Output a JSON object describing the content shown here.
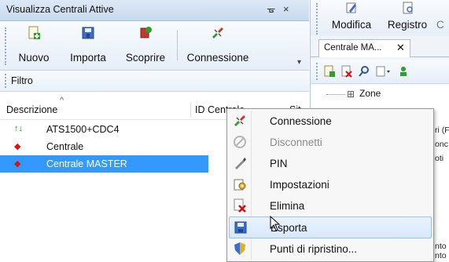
{
  "left_panel": {
    "title": "Visualizza Centrali Attive",
    "pin_glyph": "ᚗ",
    "close_glyph": "×",
    "toolbar": {
      "nuovo": "Nuovo",
      "importa": "Importa",
      "scoprire": "Scoprire",
      "connessione": "Connessione",
      "overflow_glyph": "▾"
    },
    "filter_label": "Filtro",
    "columns": {
      "descrizione": "Descrizione",
      "id_centrale": "ID Centrale",
      "site": "Sit"
    },
    "rows": [
      {
        "icon": "↑↓",
        "icon_name": "updown-arrows-icon",
        "icon_color": "#1a9e1a",
        "label": "ATS1500+CDC4"
      },
      {
        "icon": "◆",
        "icon_name": "red-diamond-icon",
        "icon_color": "#e01010",
        "label": "Centrale"
      },
      {
        "icon": "◆",
        "icon_name": "red-diamond-icon",
        "icon_color": "#e01010",
        "label": "Centrale MASTER"
      }
    ],
    "selected_row_color": "#3399ff"
  },
  "right_panel": {
    "toolbar": {
      "modifica": "Modifica",
      "registro": "Registro",
      "truncated": "C"
    },
    "tab": {
      "label": "Centrale MA...",
      "close_glyph": "✕"
    },
    "tree": {
      "zone": "Zone"
    },
    "peek_texts": [
      "ri (F",
      "onc",
      "oti",
      "nto",
      "nto"
    ]
  },
  "context_menu": {
    "items": [
      {
        "label": "Connessione",
        "icon_name": "connection-icon",
        "disabled": false,
        "highlighted": false
      },
      {
        "label": "Disconnetti",
        "icon_name": "disconnect-icon",
        "disabled": true,
        "highlighted": false
      },
      {
        "label": "PIN",
        "icon_name": "pin-pen-icon",
        "disabled": false,
        "highlighted": false
      },
      {
        "label": "Impostazioni",
        "icon_name": "settings-icon",
        "disabled": false,
        "highlighted": false
      },
      {
        "label": "Elimina",
        "icon_name": "delete-icon",
        "disabled": false,
        "highlighted": false
      },
      {
        "label": "Esporta",
        "icon_name": "save-icon",
        "disabled": false,
        "highlighted": true
      },
      {
        "label": "Punti di ripristino...",
        "icon_name": "shield-icon",
        "disabled": false,
        "highlighted": false
      }
    ]
  }
}
